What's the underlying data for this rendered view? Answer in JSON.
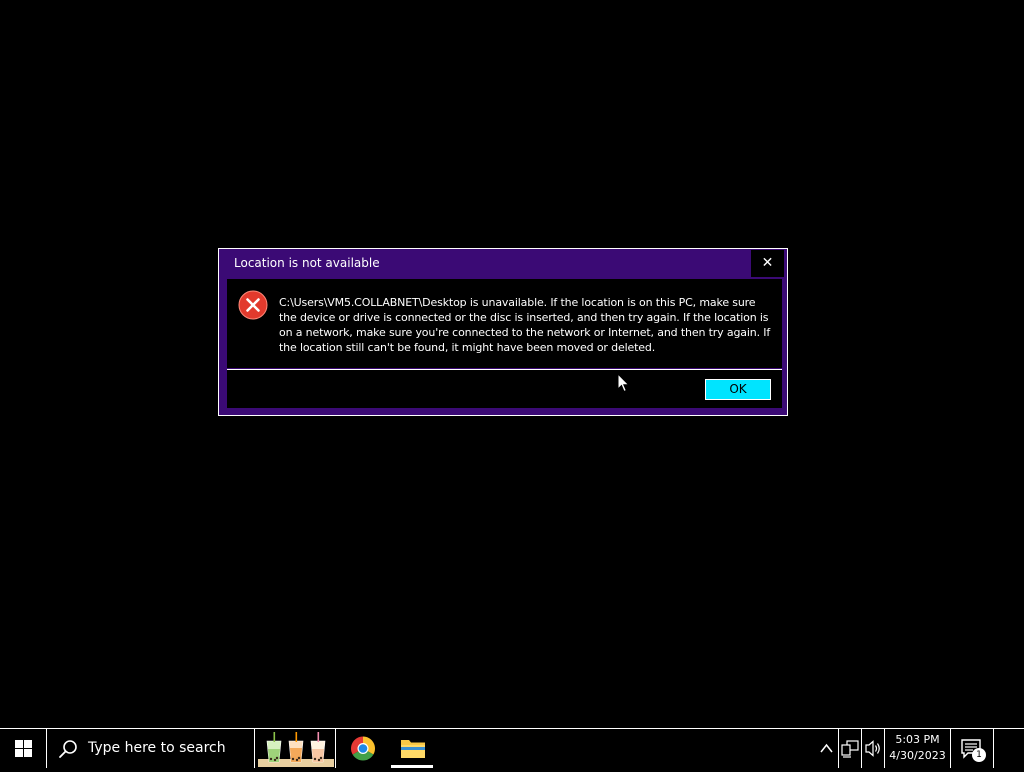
{
  "colors": {
    "dialog_frame": "#3b0a75",
    "dialog_border": "#ffffff",
    "ok_button_bg": "#00e4ff",
    "error_icon": "#e23a2d",
    "desktop": "#000000"
  },
  "dialog": {
    "title": "Location is not available",
    "close_label": "✕",
    "icon": "error-icon",
    "message": "C:\\Users\\VM5.COLLABNET\\Desktop is unavailable. If the location is on this PC, make sure the device or drive is connected or the disc is inserted, and then try again. If the location is on a network, make sure you're connected to the network or Internet, and then try again. If the location still can't be found, it might have been moved or deleted.",
    "ok_label": "OK"
  },
  "taskbar": {
    "start_icon": "windows-logo-icon",
    "search_placeholder": "Type here to search",
    "search_icon": "search-icon",
    "pinned_apps": [
      {
        "name": "bubble-tea-widget",
        "icon": "bubble-tea-icon"
      },
      {
        "name": "Google Chrome",
        "icon": "chrome-icon"
      },
      {
        "name": "File Explorer",
        "icon": "folder-icon",
        "active": true
      }
    ],
    "tray": {
      "overflow_icon": "chevron-up-icon",
      "network_icon": "network-icon",
      "volume_icon": "speaker-icon",
      "time": "5:03 PM",
      "date": "4/30/2023",
      "notification_icon": "action-center-icon",
      "notification_count": "1"
    }
  }
}
